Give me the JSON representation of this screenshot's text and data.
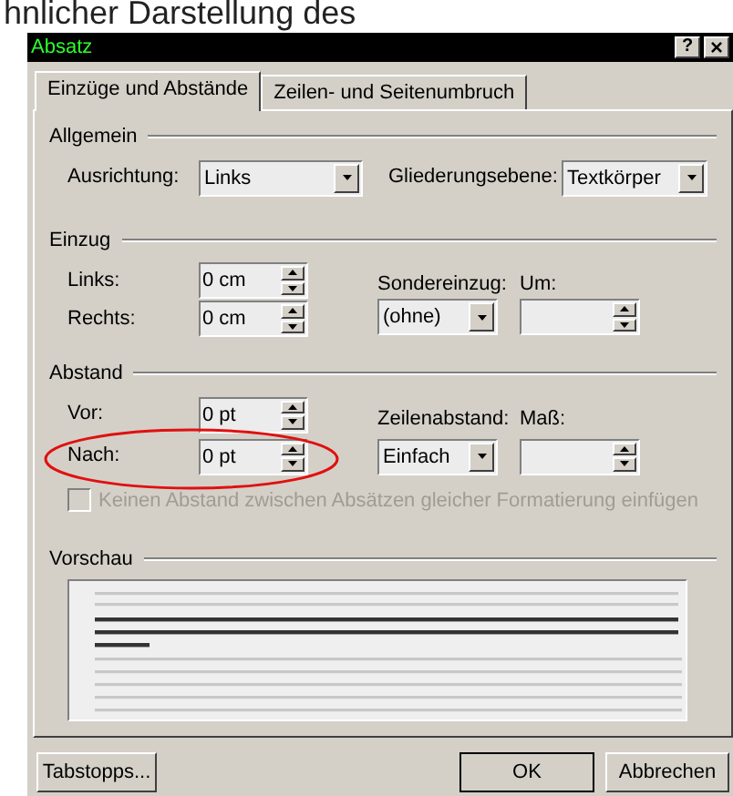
{
  "background_text": "hnlicher Darstellung des",
  "window": {
    "title": "Absatz",
    "help": "?",
    "close": "×"
  },
  "tabs": [
    {
      "label": "Einzüge und Abstände",
      "selected": true
    },
    {
      "label": "Zeilen- und Seitenumbruch",
      "selected": false
    }
  ],
  "general": {
    "heading": "Allgemein",
    "alignment": {
      "label": "Ausrichtung:",
      "value": "Links"
    },
    "outline_level": {
      "label": "Gliederungsebene:",
      "value": "Textkörper"
    }
  },
  "indent": {
    "heading": "Einzug",
    "left": {
      "label": "Links:",
      "value": "0 cm"
    },
    "right": {
      "label": "Rechts:",
      "value": "0 cm"
    },
    "special": {
      "label": "Sondereinzug:",
      "value": "(ohne)"
    },
    "by": {
      "label": "Um:"
    }
  },
  "spacing": {
    "heading": "Abstand",
    "before": {
      "label": "Vor:",
      "value": "0 pt"
    },
    "after": {
      "label": "Nach:",
      "value": "0 pt"
    },
    "line_spacing": {
      "label": "Zeilenabstand:",
      "value": "Einfach"
    },
    "at": {
      "label": "Maß:"
    },
    "no_space_checkbox": {
      "label": "Keinen Abstand zwischen Absätzen gleicher Formatierung einfügen",
      "checked": false,
      "disabled": true
    }
  },
  "preview": {
    "heading": "Vorschau"
  },
  "buttons": [
    {
      "label": "Tabstopps...",
      "default": false
    },
    {
      "label": "OK",
      "default": true
    },
    {
      "label": "Abbrechen",
      "default": false
    }
  ]
}
